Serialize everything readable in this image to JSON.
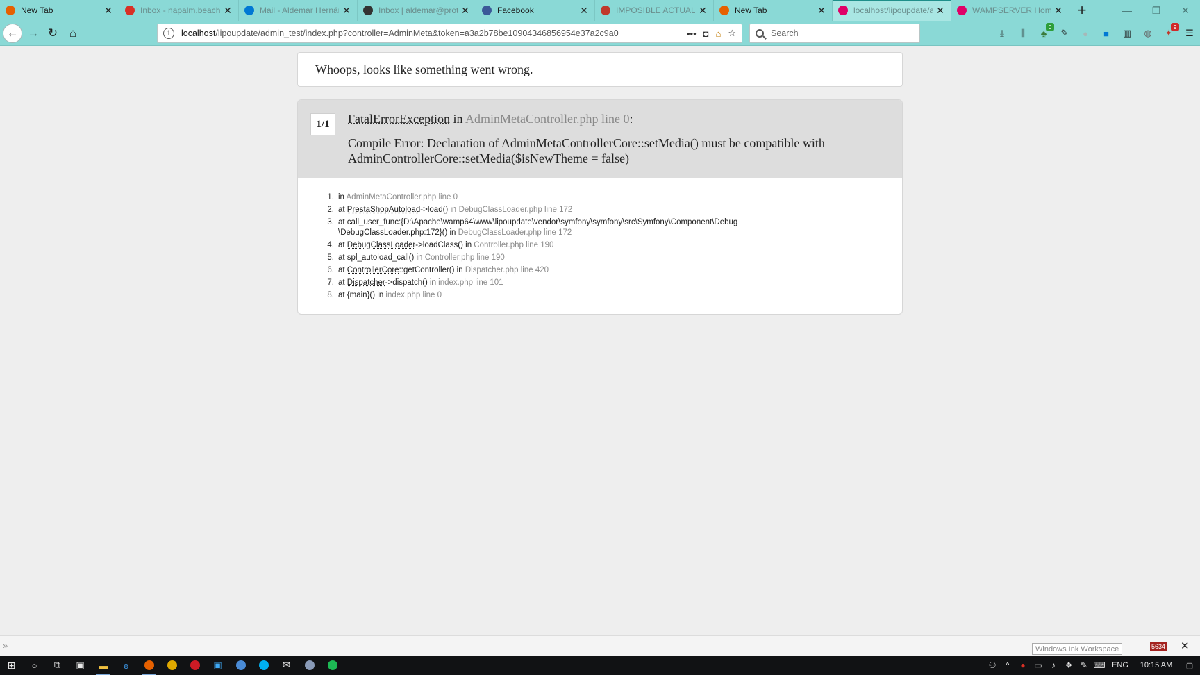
{
  "browser": {
    "tabs": [
      {
        "title": "New Tab",
        "favicon": "firefox-icon",
        "color": "#e66000"
      },
      {
        "title": "Inbox - napalm.beach@",
        "favicon": "gmail-icon",
        "color": "#d93025"
      },
      {
        "title": "Mail - Aldemar Hernánd",
        "favicon": "outlook-icon",
        "color": "#0078d4"
      },
      {
        "title": "Inbox | aldemar@proton",
        "favicon": "protonmail-icon",
        "color": "#333333"
      },
      {
        "title": "Facebook",
        "favicon": "facebook-icon",
        "color": "#3b5998"
      },
      {
        "title": "IMPOSIBLE ACTUALIZAR",
        "favicon": "prestashop-icon",
        "color": "#c0392b"
      },
      {
        "title": "New Tab",
        "favicon": "firefox-icon",
        "color": "#e66000"
      },
      {
        "title": "localhost/lipoupdate/ad",
        "favicon": "prestashop-icon",
        "color": "#df0067"
      },
      {
        "title": "WAMPSERVER Homepa",
        "favicon": "wampserver-icon",
        "color": "#df0067"
      }
    ],
    "new_tab_label": "+",
    "url_host": "localhost",
    "url_rest": "/lipoupdate/admin_test/index.php?controller=AdminMeta&token=a3a2b78be10904346856954e37a2c9a0",
    "search_placeholder": "Search",
    "accent": "#8ad9d6"
  },
  "toolbar_badges": {
    "extension_count": "0",
    "notification_count": "9"
  },
  "page": {
    "heading": "Whoops, looks like something went wrong.",
    "counter": "1/1",
    "exception": {
      "class": "FatalErrorException",
      "in_text": " in ",
      "file": "AdminMetaController.php line 0",
      "colon": ":",
      "message": "Compile Error: Declaration of AdminMetaControllerCore::setMedia() must be compatible with AdminControllerCore::setMedia($isNewTheme = false)"
    },
    "trace": [
      {
        "num": "1.",
        "prefix": "in ",
        "cls": "",
        "call": "",
        "in": "",
        "loc": "AdminMetaController.php line 0"
      },
      {
        "num": "2.",
        "prefix": "at ",
        "cls": "PrestaShopAutoload",
        "call": "->load()",
        "in": " in ",
        "loc": "DebugClassLoader.php line 172"
      },
      {
        "num": "3.",
        "prefix": "at ",
        "cls": "",
        "call": "call_user_func:{D:\\Apache\\wamp64\\www\\lipoupdate\\vendor\\symfony\\symfony\\src\\Symfony\\Component\\Debug \\DebugClassLoader.php:172}()",
        "in": " in ",
        "loc": "DebugClassLoader.php line 172"
      },
      {
        "num": "4.",
        "prefix": "at ",
        "cls": "DebugClassLoader",
        "call": "->loadClass()",
        "in": " in ",
        "loc": "Controller.php line 190"
      },
      {
        "num": "5.",
        "prefix": "at ",
        "cls": "",
        "call": "spl_autoload_call()",
        "in": " in ",
        "loc": "Controller.php line 190"
      },
      {
        "num": "6.",
        "prefix": "at ",
        "cls": "ControllerCore",
        "call": "::getController()",
        "in": " in ",
        "loc": "Dispatcher.php line 420"
      },
      {
        "num": "7.",
        "prefix": "at ",
        "cls": "Dispatcher",
        "call": "->dispatch()",
        "in": " in ",
        "loc": "index.php line 101"
      },
      {
        "num": "8.",
        "prefix": "at ",
        "cls": "",
        "call": "{main}()",
        "in": " in ",
        "loc": "index.php line 0"
      }
    ]
  },
  "statusbar": {
    "ink_label": "Windows Ink Workspace",
    "badge": "5634"
  },
  "taskbar": {
    "language": "ENG",
    "time": "10:15 AM"
  }
}
